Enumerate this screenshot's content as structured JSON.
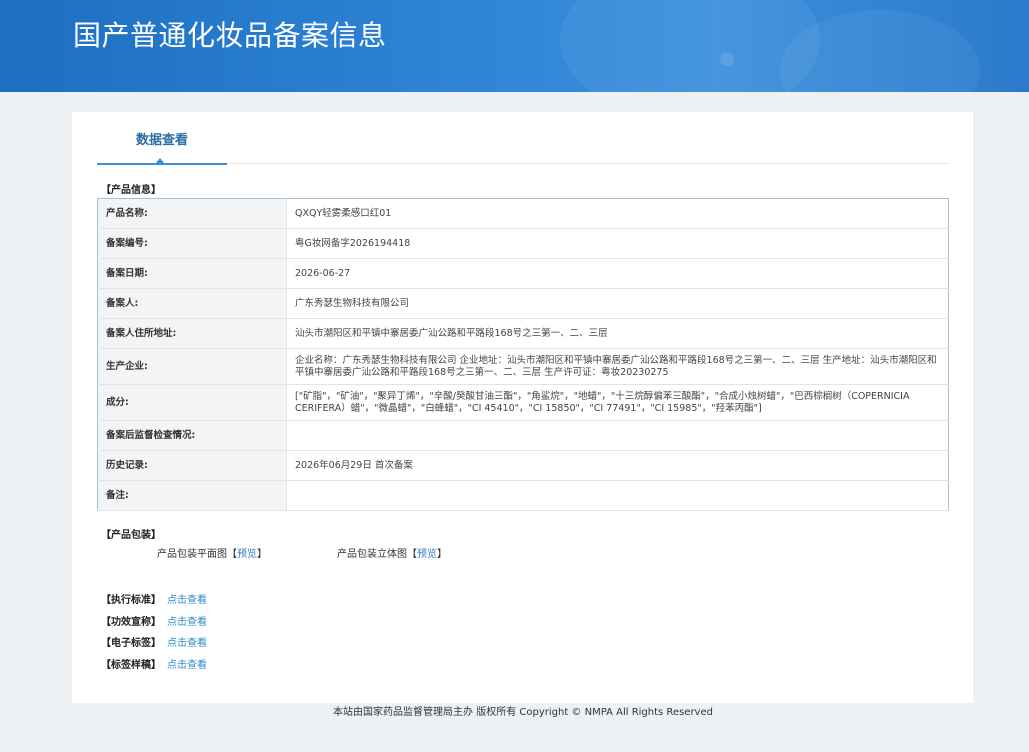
{
  "header": {
    "title": "国产普通化妆品备案信息"
  },
  "tabs": [
    {
      "label": "数据查看"
    }
  ],
  "product_info": {
    "section_label": "【产品信息】",
    "rows": [
      {
        "key": "产品名称:",
        "value": "QXQY轻雾柔感口红01"
      },
      {
        "key": "备案编号:",
        "value": "粤G妆网备字2026194418"
      },
      {
        "key": "备案日期:",
        "value": "2026-06-27"
      },
      {
        "key": "备案人:",
        "value": "广东秀瑟生物科技有限公司"
      },
      {
        "key": "备案人住所地址:",
        "value": "汕头市潮阳区和平镇中寨居委广汕公路和平路段168号之三第一、二、三层"
      },
      {
        "key": "生产企业:",
        "value": "企业名称：广东秀瑟生物科技有限公司 企业地址：汕头市潮阳区和平镇中寨居委广汕公路和平路段168号之三第一、二、三层 生产地址：汕头市潮阳区和平镇中寨居委广汕公路和平路段168号之三第一、二、三层 生产许可证：粤妆20230275"
      },
      {
        "key": "成分:",
        "value": "[\"矿脂\"，\"矿油\"，\"聚异丁烯\"，\"辛酸/癸酸甘油三酯\"，\"角鲨烷\"，\"地蜡\"，\"十三烷醇偏苯三酸酯\"，\"合成小烛树蜡\"，\"巴西棕榈树（COPERNICIA CERIFERA）蜡\"，\"微晶蜡\"，\"白蜂蜡\"，\"CI 45410\"，\"CI 15850\"，\"CI 77491\"，\"CI 15985\"，\"羟苯丙酯\"]"
      },
      {
        "key": "备案后监督检查情况:",
        "value": ""
      },
      {
        "key": "历史记录:",
        "value": "2026年06月29日 首次备案"
      },
      {
        "key": "备注:",
        "value": ""
      }
    ]
  },
  "packaging": {
    "section_label": "【产品包装】",
    "flat_label": "产品包装平面图",
    "threed_label": "产品包装立体图",
    "bracket_open": "【",
    "preview_link": "预览",
    "bracket_close": "】"
  },
  "extras": [
    {
      "label": "【执行标准】",
      "link": "点击查看"
    },
    {
      "label": "【功效宣称】",
      "link": "点击查看"
    },
    {
      "label": "【电子标签】",
      "link": "点击查看"
    },
    {
      "label": "【标签样稿】",
      "link": "点击查看"
    }
  ],
  "footer": {
    "text": "本站由国家药品监督管理局主办 版权所有 Copyright © NMPA All Rights Reserved"
  }
}
